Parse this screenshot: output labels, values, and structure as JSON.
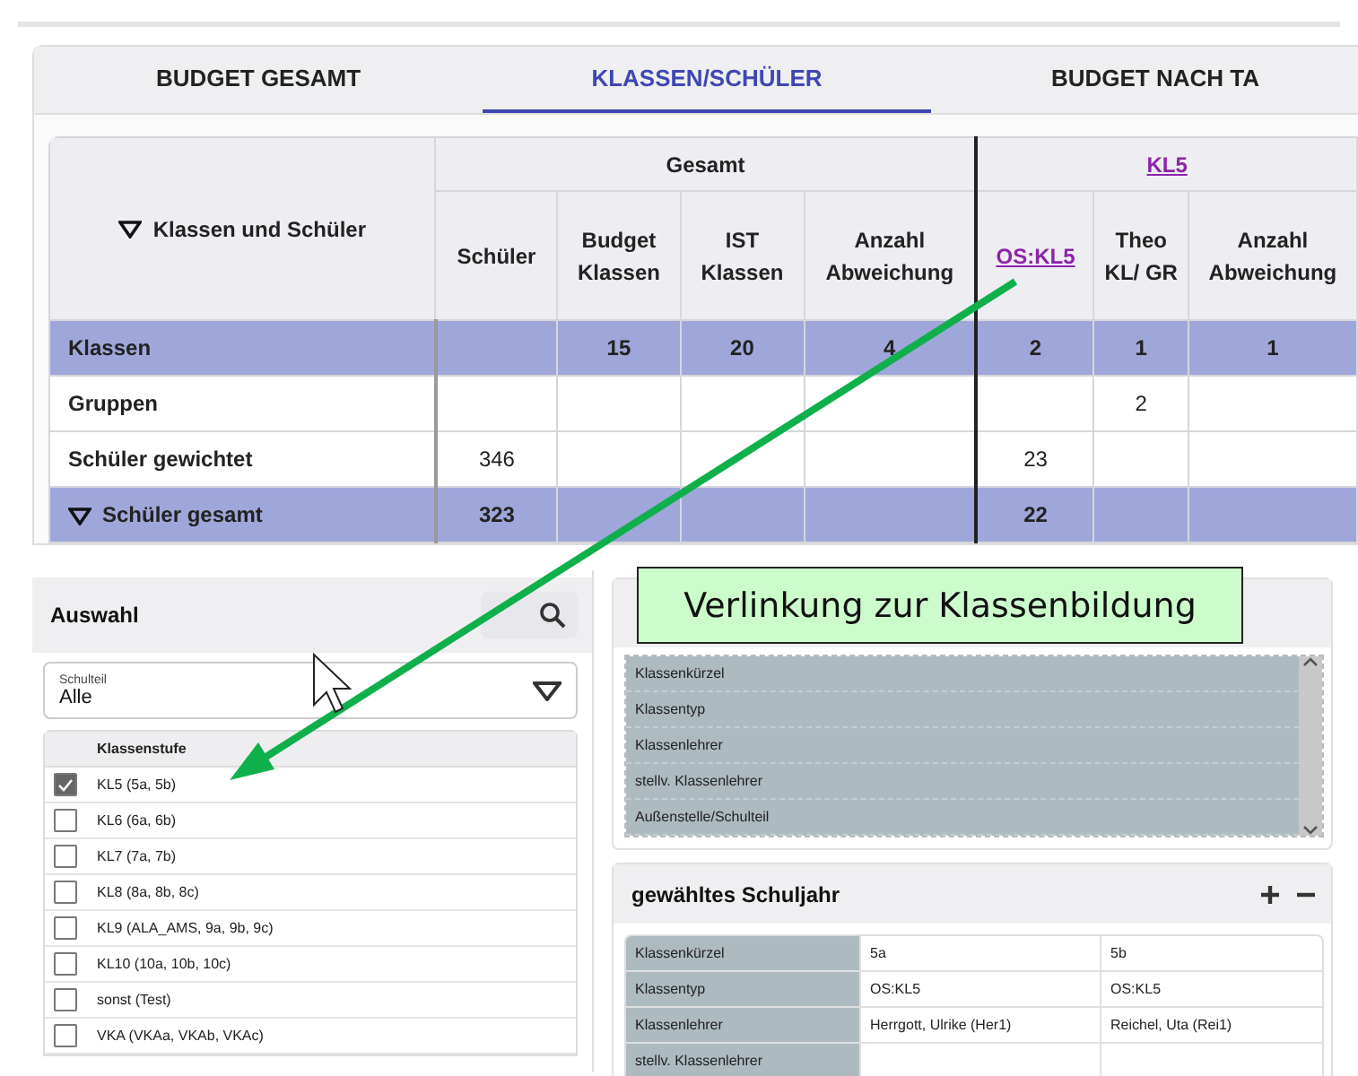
{
  "tabs": [
    {
      "label": "BUDGET GESAMT",
      "selected": false
    },
    {
      "label": "KLASSEN/SCHÜLER",
      "selected": true
    },
    {
      "label": "BUDGET NACH TA",
      "selected": false
    }
  ],
  "table": {
    "corner": {
      "label": "Klassen und Schüler",
      "expanded": true
    },
    "groups": [
      {
        "label": "Gesamt",
        "kind": "plain"
      },
      {
        "label": "KL5",
        "kind": "link"
      }
    ],
    "columns": [
      {
        "label": "Schüler",
        "kind": "plain"
      },
      {
        "label": "Budget Klassen",
        "kind": "plain"
      },
      {
        "label": "IST Klassen",
        "kind": "plain"
      },
      {
        "label": "Anzahl Abweichung",
        "kind": "plain"
      },
      {
        "label": "OS:KL5",
        "kind": "link"
      },
      {
        "label": "Theo KL/ GR",
        "kind": "plain"
      },
      {
        "label": "Anzahl Abweichung",
        "kind": "plain"
      }
    ],
    "rows": [
      {
        "label": "Klassen",
        "kind": "summary",
        "cells": [
          null,
          "15",
          "20",
          "4",
          "2",
          "1",
          "1"
        ]
      },
      {
        "label": "Gruppen",
        "kind": "plain",
        "cells": [
          null,
          null,
          null,
          null,
          null,
          "2",
          null
        ]
      },
      {
        "label": "Schüler gewichtet",
        "kind": "plain",
        "cells": [
          "346",
          null,
          null,
          null,
          "23",
          null,
          null
        ]
      },
      {
        "label": "Schüler gesamt",
        "kind": "summary",
        "expanded": true,
        "cells": [
          "323",
          null,
          null,
          null,
          "22",
          null,
          null
        ]
      }
    ]
  },
  "selection": {
    "title": "Auswahl",
    "select": {
      "label": "Schulteil",
      "value": "Alle"
    },
    "list_header": "Klassenstufe",
    "items": [
      {
        "label": "KL5 (5a, 5b)",
        "checked": true
      },
      {
        "label": "KL6 (6a, 6b)",
        "checked": false
      },
      {
        "label": "KL7 (7a, 7b)",
        "checked": false
      },
      {
        "label": "KL8 (8a, 8b, 8c)",
        "checked": false
      },
      {
        "label": "KL9 (ALA_AMS, 9a, 9b, 9c)",
        "checked": false
      },
      {
        "label": "KL10 (10a, 10b, 10c)",
        "checked": false
      },
      {
        "label": "sonst (Test)",
        "checked": false
      },
      {
        "label": "VKA (VKAa, VKAb, VKAc)",
        "checked": false
      }
    ]
  },
  "preview": {
    "rows": [
      "Klassenkürzel",
      "Klassentyp",
      "Klassenlehrer",
      "stellv. Klassenlehrer",
      "Außenstelle/Schulteil"
    ]
  },
  "school_year": {
    "title": "gewähltes Schuljahr",
    "rows": [
      {
        "label": "Klassenkürzel",
        "values": [
          "5a",
          "5b"
        ]
      },
      {
        "label": "Klassentyp",
        "values": [
          "OS:KL5",
          "OS:KL5"
        ]
      },
      {
        "label": "Klassenlehrer",
        "values": [
          "Herrgott, Ulrike (Her1)",
          "Reichel, Uta (Rei1)"
        ]
      },
      {
        "label": "stellv. Klassenlehrer"
      }
    ]
  },
  "annotation": {
    "text": "Verlinkung zur Klassenbildung"
  }
}
